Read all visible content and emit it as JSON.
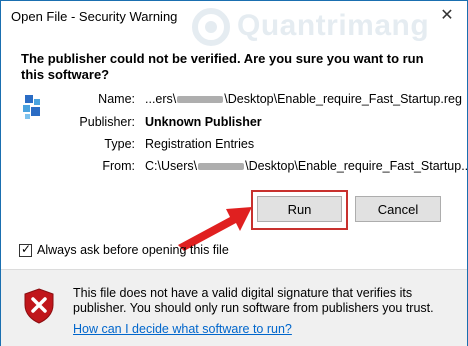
{
  "window": {
    "title": "Open File - Security Warning",
    "close_glyph": "✕",
    "watermark": "Quantrimang"
  },
  "question": "The publisher could not be verified.  Are you sure you want to run this software?",
  "fields": {
    "name_label": "Name:",
    "name_value_prefix": "...ers\\",
    "name_value_suffix": "\\Desktop\\Enable_require_Fast_Startup.reg",
    "publisher_label": "Publisher:",
    "publisher_value": "Unknown Publisher",
    "type_label": "Type:",
    "type_value": "Registration Entries",
    "from_label": "From:",
    "from_value_prefix": "C:\\Users\\",
    "from_value_suffix": "\\Desktop\\Enable_require_Fast_Startup..."
  },
  "buttons": {
    "run": "Run",
    "cancel": "Cancel"
  },
  "checkbox": {
    "label": "Always ask before opening this file",
    "checked": true
  },
  "footer": {
    "warning": "This file does not have a valid digital signature that verifies its publisher. You should only run software from publishers you trust.",
    "help_link": "How can I decide what software to run?"
  },
  "colors": {
    "highlight_outline": "#c8312e",
    "arrow": "#e02020",
    "link": "#0066cc",
    "shield": "#c0161b"
  },
  "icons": [
    "registry-file-icon",
    "close-icon",
    "checkbox-check-icon",
    "red-arrow-icon",
    "shield-warning-icon"
  ]
}
